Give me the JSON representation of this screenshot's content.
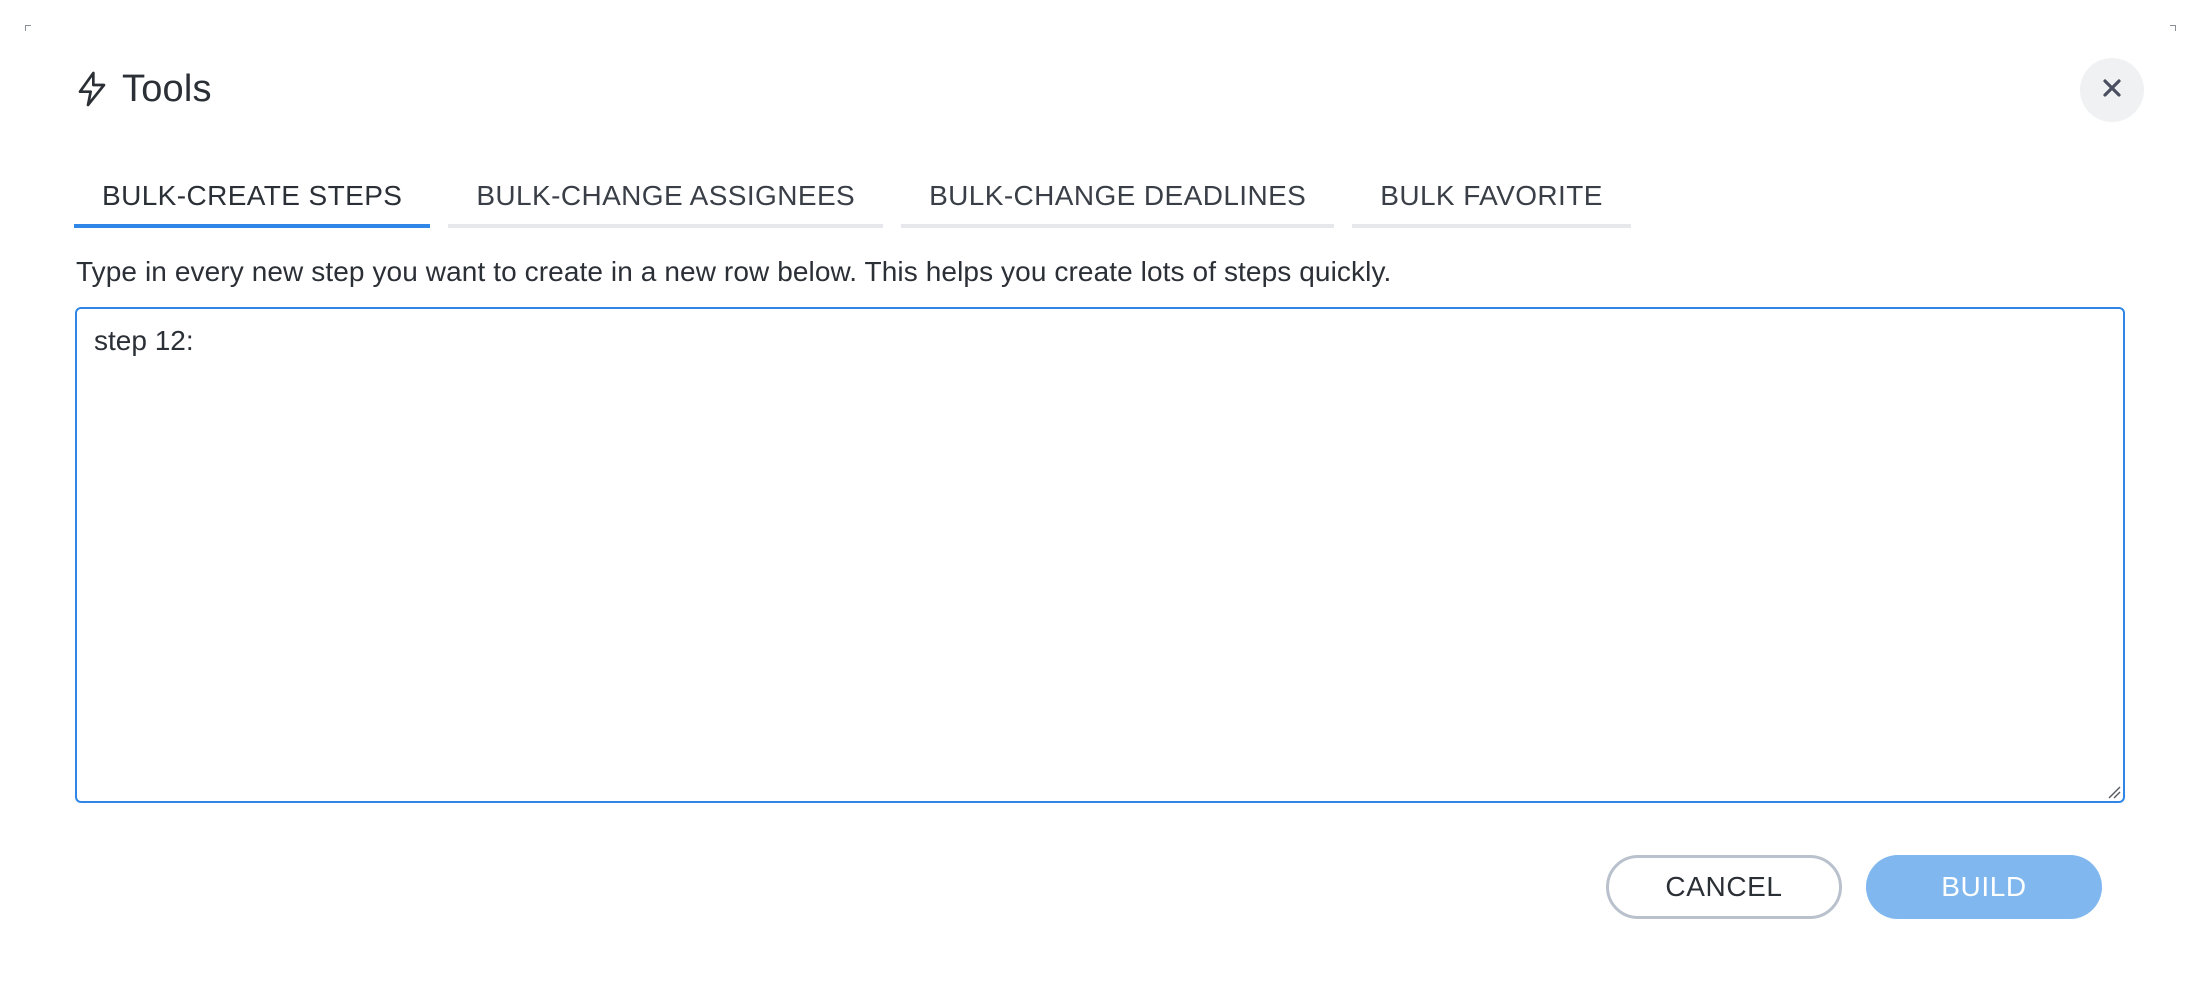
{
  "dialog": {
    "title": "Tools",
    "title_icon": "lightning-bolt-icon",
    "close_icon": "close-icon"
  },
  "tabs": [
    {
      "label": "BULK-CREATE STEPS",
      "active": true
    },
    {
      "label": "BULK-CHANGE ASSIGNEES",
      "active": false
    },
    {
      "label": "BULK-CHANGE DEADLINES",
      "active": false
    },
    {
      "label": "BULK FAVORITE",
      "active": false
    }
  ],
  "content": {
    "description": "Type in every new step you want to create in a new row below. This helps you create lots of steps quickly.",
    "steps_input_value": "step 12:"
  },
  "actions": {
    "cancel_label": "CANCEL",
    "build_label": "BUILD"
  },
  "colors": {
    "accent": "#2f86e6",
    "build_button": "#7fb7ee",
    "cancel_border": "#b9c1cc"
  }
}
